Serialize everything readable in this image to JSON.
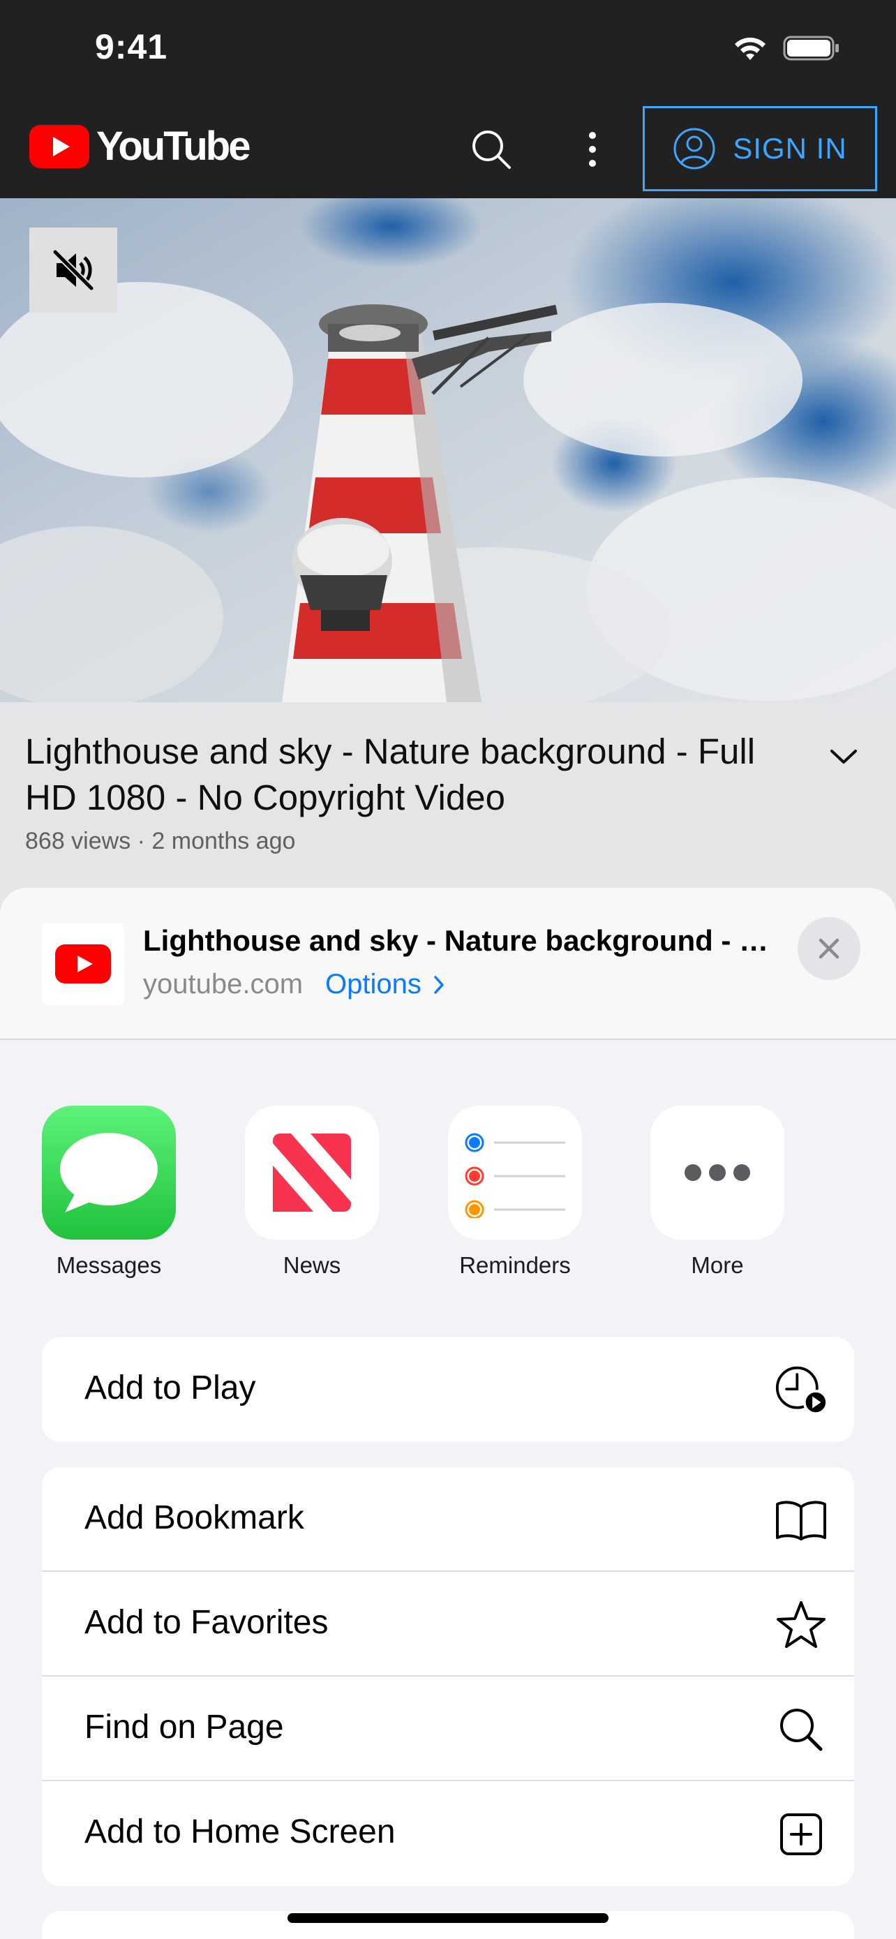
{
  "status_bar": {
    "time": "9:41"
  },
  "header": {
    "logo_text": "YouTube",
    "sign_in_label": "SIGN IN"
  },
  "video": {
    "title": "Lighthouse and sky - Nature background - Full HD 1080 - No Copyright Video",
    "meta": "868 views · 2 months ago"
  },
  "share_sheet": {
    "title": "Lighthouse and sky -  Nature background - Full HD 1080 - No Copyright Video",
    "domain": "youtube.com",
    "options_label": "Options",
    "apps": [
      {
        "label": "Messages",
        "icon": "messages-icon"
      },
      {
        "label": "News",
        "icon": "news-icon"
      },
      {
        "label": "Reminders",
        "icon": "reminders-icon"
      },
      {
        "label": "More",
        "icon": "more-icon"
      }
    ],
    "actions_group1": [
      {
        "label": "Add to Play",
        "icon": "clock-play-icon"
      }
    ],
    "actions_group2": [
      {
        "label": "Add Bookmark",
        "icon": "book-icon"
      },
      {
        "label": "Add to Favorites",
        "icon": "star-icon"
      },
      {
        "label": "Find on Page",
        "icon": "search-icon"
      },
      {
        "label": "Add to Home Screen",
        "icon": "plus-square-icon"
      }
    ]
  },
  "colors": {
    "youtube_red": "#ff0000",
    "link_blue": "#0a7aff",
    "sign_in_blue": "#3ea6ff",
    "header_bg": "#212121",
    "messages_green": "#34c759",
    "news_red": "#f8334f"
  }
}
